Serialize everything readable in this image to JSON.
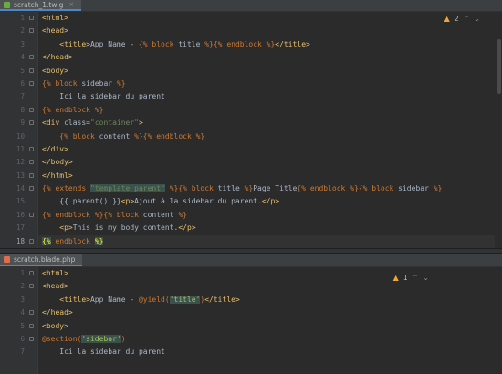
{
  "editor_top": {
    "tab": {
      "label": "scratch_1.twig",
      "icon": "twig-file-icon"
    },
    "inspection": {
      "count": "2"
    },
    "line_numbers": [
      "1",
      "2",
      "3",
      "4",
      "5",
      "6",
      "7",
      "8",
      "9",
      "10",
      "11",
      "12",
      "13",
      "14",
      "15",
      "16",
      "17",
      "18"
    ],
    "current_line": "18",
    "lines": [
      [
        [
          "tag",
          "<html>"
        ]
      ],
      [
        [
          "tag",
          "<head>"
        ]
      ],
      [
        [
          "txt",
          "    "
        ],
        [
          "tag",
          "<title>"
        ],
        [
          "txt",
          "App Name - "
        ],
        [
          "kw",
          "{% block "
        ],
        [
          "txt",
          "title "
        ],
        [
          "kw",
          "%}{% endblock %}"
        ],
        [
          "tag",
          "</title>"
        ]
      ],
      [
        [
          "tag",
          "</head>"
        ]
      ],
      [
        [
          "tag",
          "<body>"
        ]
      ],
      [
        [
          "kw",
          "{% block "
        ],
        [
          "txt",
          "sidebar "
        ],
        [
          "kw",
          "%}"
        ]
      ],
      [
        [
          "txt",
          "    Ici la sidebar du parent"
        ]
      ],
      [
        [
          "kw",
          "{% endblock %}"
        ]
      ],
      [
        [
          "tag",
          "<div "
        ],
        [
          "txt",
          "class="
        ],
        [
          "str",
          "\"container\""
        ],
        [
          "tag",
          ">"
        ]
      ],
      [
        [
          "txt",
          "    "
        ],
        [
          "kw",
          "{% block "
        ],
        [
          "txt",
          "content "
        ],
        [
          "kw",
          "%}{% endblock %}"
        ]
      ],
      [
        [
          "tag",
          "</div>"
        ]
      ],
      [
        [
          "tag",
          "</body>"
        ]
      ],
      [
        [
          "tag",
          "</html>"
        ]
      ],
      [
        [
          "kw",
          "{% extends "
        ],
        [
          "hl",
          "\"template_parent\""
        ],
        [
          "kw",
          " %}{% block "
        ],
        [
          "txt",
          "title "
        ],
        [
          "kw",
          "%}"
        ],
        [
          "txt",
          "Page Title"
        ],
        [
          "kw",
          "{% endblock %}{% block "
        ],
        [
          "txt",
          "sidebar "
        ],
        [
          "kw",
          "%}"
        ]
      ],
      [
        [
          "txt",
          "    {{ parent() }}"
        ],
        [
          "tag",
          "<p>"
        ],
        [
          "txt",
          "Ajout à la sidebar du parent."
        ],
        [
          "tag",
          "</p>"
        ]
      ],
      [
        [
          "kw",
          "{% endblock %}{% block "
        ],
        [
          "txt",
          "content "
        ],
        [
          "kw",
          "%}"
        ]
      ],
      [
        [
          "txt",
          "    "
        ],
        [
          "tag",
          "<p>"
        ],
        [
          "txt",
          "This is my body content."
        ],
        [
          "tag",
          "</p>"
        ]
      ],
      [
        [
          "brmatch",
          "{%"
        ],
        [
          "kw",
          " endblock "
        ],
        [
          "brmatch",
          "%}"
        ]
      ]
    ]
  },
  "editor_bottom": {
    "tab": {
      "label": "scratch.blade.php",
      "icon": "blade-file-icon"
    },
    "inspection": {
      "count": "1"
    },
    "line_numbers": [
      "1",
      "2",
      "3",
      "4",
      "5",
      "6",
      "7"
    ],
    "lines": [
      [
        [
          "tag",
          "<html>"
        ]
      ],
      [
        [
          "tag",
          "<head>"
        ]
      ],
      [
        [
          "txt",
          "    "
        ],
        [
          "tag",
          "<title>"
        ],
        [
          "txt",
          "App Name - "
        ],
        [
          "kw",
          "@yield("
        ],
        [
          "hl2",
          "'title'"
        ],
        [
          "kw",
          ")"
        ],
        [
          "tag",
          "</title>"
        ]
      ],
      [
        [
          "tag",
          "</head>"
        ]
      ],
      [
        [
          "tag",
          "<body>"
        ]
      ],
      [
        [
          "kw",
          "@section("
        ],
        [
          "hl2",
          "'sidebar'"
        ],
        [
          "kw",
          ")"
        ]
      ],
      [
        [
          "txt",
          "    Ici la sidebar du parent"
        ]
      ]
    ]
  },
  "colors": {
    "background": "#2b2b2b",
    "gutter": "#313335",
    "tag": "#e8bf6a",
    "keyword": "#cc7832",
    "string": "#6a8759",
    "text": "#a9b7c6",
    "warning": "#f0a732"
  }
}
